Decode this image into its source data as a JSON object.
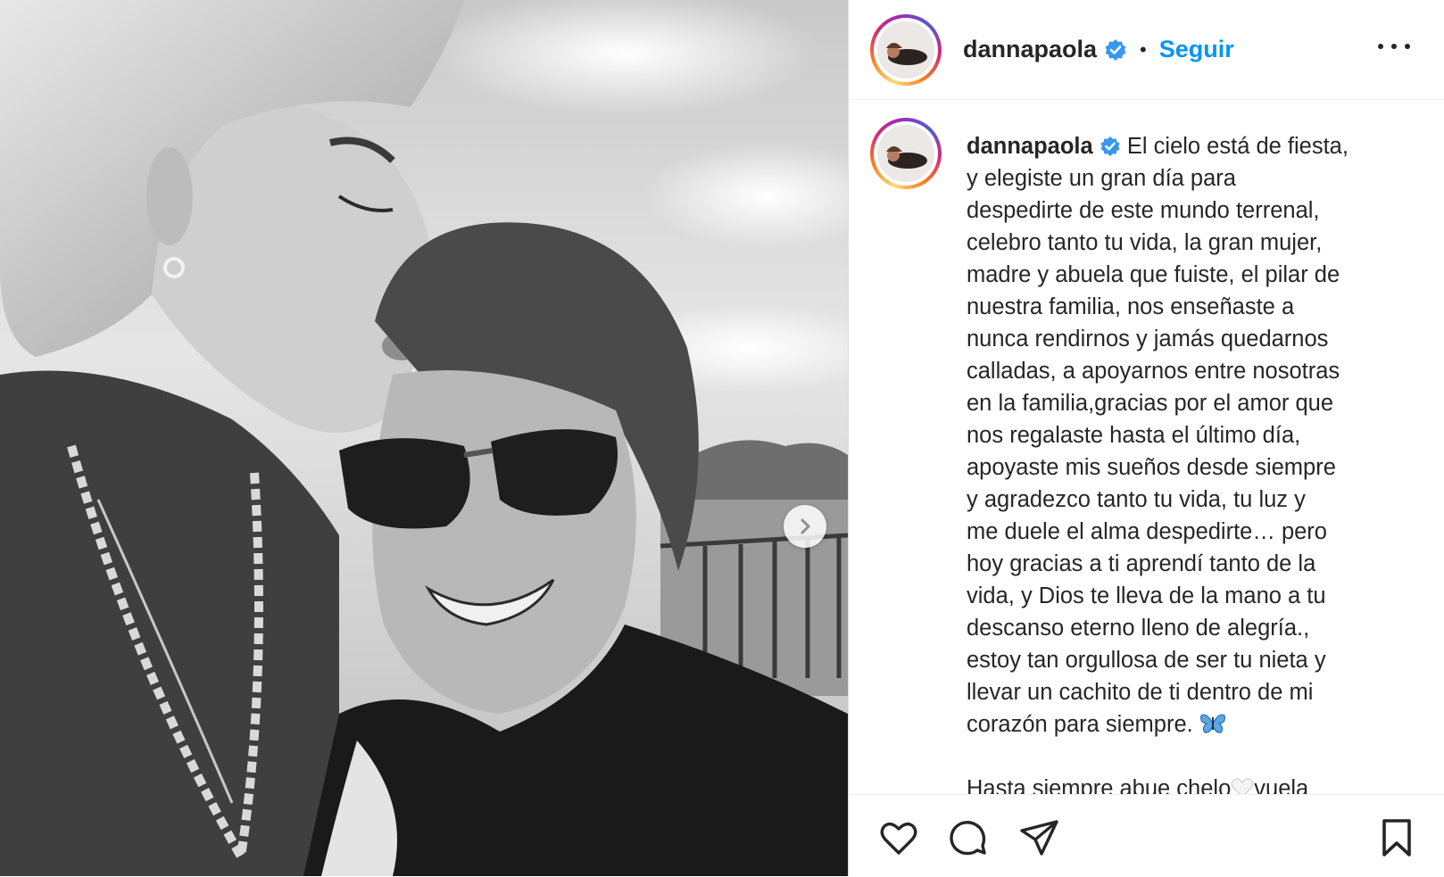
{
  "post": {
    "username": "dannapaola",
    "verified": true,
    "follow_label": "Seguir",
    "separator": "•",
    "more_icon": "more-options-icon"
  },
  "caption": {
    "username": "dannapaola",
    "lines": [
      "El cielo está de fiesta,",
      "y elegiste un gran día para",
      "despedirte de este mundo terrenal,",
      "celebro tanto tu vida, la gran mujer,",
      "madre y abuela que fuiste, el pilar de",
      "nuestra familia, nos enseñaste a",
      "nunca rendirnos y jamás quedarnos",
      "calladas, a apoyarnos entre nosotras",
      "en la familia,gracias por el amor que",
      "nos regalaste hasta el último día,",
      "apoyaste mis sueños desde siempre",
      "y agradezco tanto tu vida, tu luz y",
      "me duele el alma despedirte… pero",
      "hoy gracias a ti aprendí tanto de la",
      "vida, y Dios te lleva de la mano a tu",
      "descanso eterno lleno de alegría.,",
      "estoy tan orgullosa de ser tu nieta y",
      "llevar un cachito de ti dentro de mi",
      "corazón para siempre."
    ],
    "closing_before": "Hasta siempre abue chelo",
    "closing_after": "vuela"
  },
  "icons": {
    "like": "heart-icon",
    "comment": "comment-icon",
    "share": "send-icon",
    "save": "bookmark-icon",
    "next": "chevron-right-icon",
    "verified": "verified-badge-icon",
    "emoji_butterfly": "butterfly-emoji-icon",
    "emoji_heart": "white-heart-emoji-icon"
  },
  "colors": {
    "accent": "#0095f6",
    "text": "#262626",
    "verified": "#3897f0"
  }
}
